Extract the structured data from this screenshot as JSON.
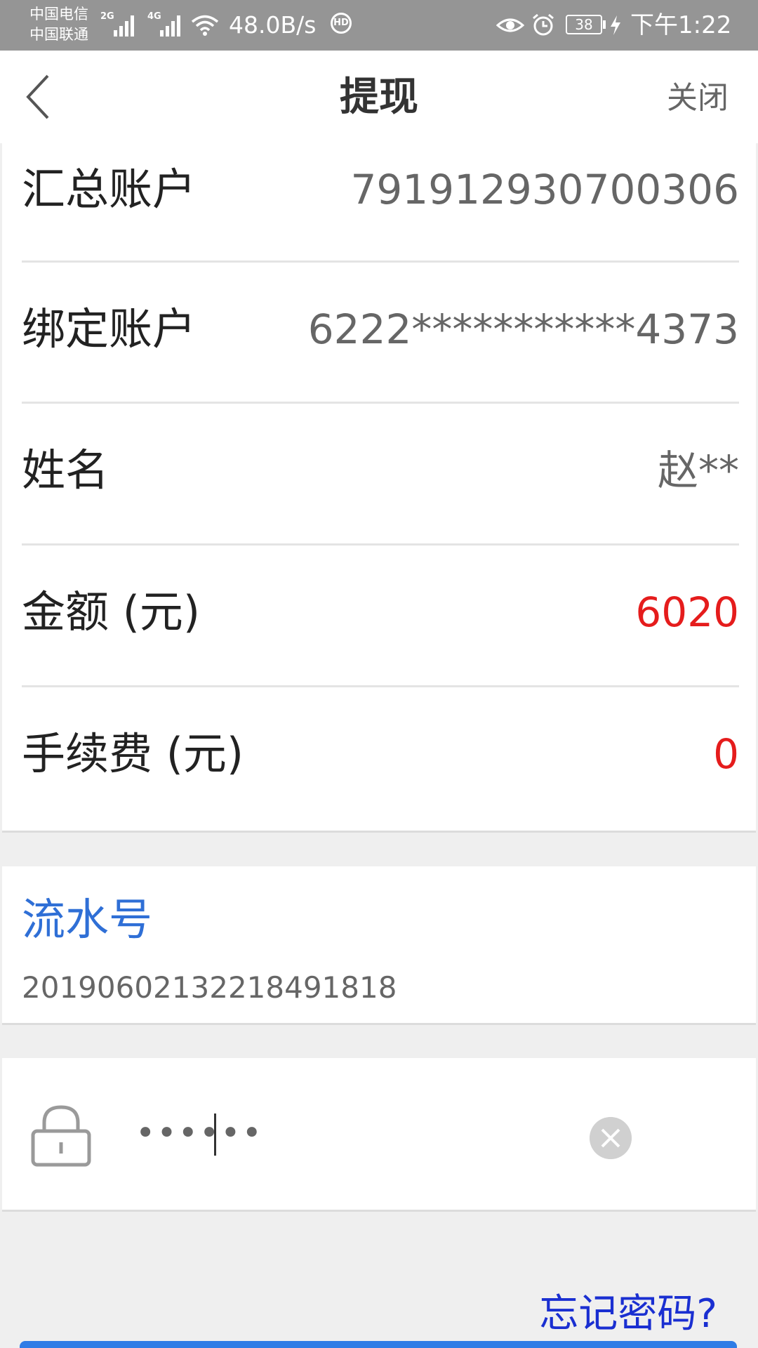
{
  "status_bar": {
    "carrier_1": "中国电信",
    "carrier_2": "中国联通",
    "net_1": "2G",
    "net_2": "4G",
    "speed": "48.0B/s",
    "hd_badge": "HD",
    "battery": "38",
    "time": "下午1:22"
  },
  "nav": {
    "title": "提现",
    "close_label": "关闭"
  },
  "info_rows": [
    {
      "label": "汇总账户",
      "value": "791912930700306"
    },
    {
      "label": "绑定账户",
      "value": "6222***********4373"
    },
    {
      "label": "姓名",
      "value": "赵**"
    },
    {
      "label": "金额 (元)",
      "value": "6020"
    },
    {
      "label": "手续费 (元)",
      "value": "0"
    }
  ],
  "serial": {
    "title": "流水号",
    "value": "20190602132218491818"
  },
  "password": {
    "value": "••••••"
  },
  "forgot_password_label": "忘记密码?",
  "colors": {
    "accent_blue": "#2f6fd6",
    "link_blue": "#1a2fd1",
    "amount_red": "#e51c1c",
    "status_bar": "#959595"
  },
  "icons": [
    "back-arrow-icon",
    "lock-icon",
    "clear-icon",
    "wifi-icon",
    "eye-icon",
    "alarm-icon",
    "battery-icon",
    "charging-icon",
    "signal-icon"
  ]
}
